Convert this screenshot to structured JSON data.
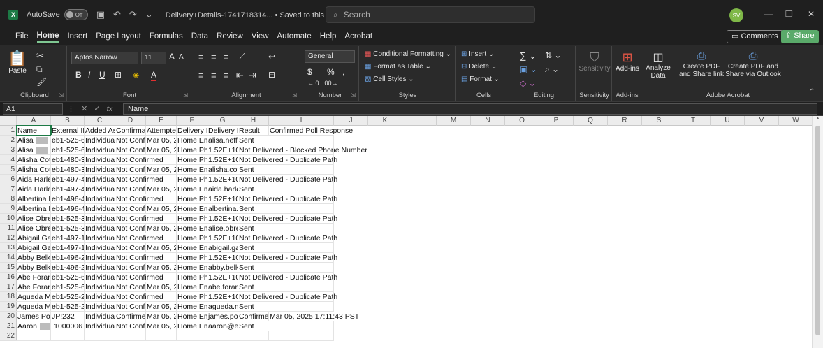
{
  "titlebar": {
    "app_logo": "X",
    "autosave_label": "AutoSave",
    "autosave_state": "Off",
    "doc_title": "Delivery+Details-1741718314... • Saved to this PC ∨",
    "search_placeholder": "Search",
    "user_initials": "SV"
  },
  "menu": {
    "tabs": [
      "File",
      "Home",
      "Insert",
      "Page Layout",
      "Formulas",
      "Data",
      "Review",
      "View",
      "Automate",
      "Help",
      "Acrobat"
    ],
    "active": "Home",
    "comments": "Comments",
    "share": "Share"
  },
  "ribbon": {
    "clipboard": {
      "paste": "Paste",
      "label": "Clipboard"
    },
    "font": {
      "name": "Aptos Narrow",
      "size": "11",
      "label": "Font"
    },
    "alignment": {
      "label": "Alignment"
    },
    "number": {
      "format": "General",
      "label": "Number"
    },
    "styles": {
      "conditional": "Conditional Formatting",
      "table": "Format as Table",
      "cell": "Cell Styles",
      "label": "Styles"
    },
    "cells": {
      "insert": "Insert",
      "delete": "Delete",
      "format": "Format",
      "label": "Cells"
    },
    "editing": {
      "label": "Editing"
    },
    "sensitivity": {
      "btn": "Sensitivity",
      "label": "Sensitivity"
    },
    "addins": {
      "btn": "Add-ins",
      "label": "Add-ins"
    },
    "analyze": {
      "btn1": "Analyze",
      "btn2": "Data"
    },
    "acrobat": {
      "pdf1a": "Create PDF",
      "pdf1b": "and Share link",
      "pdf2a": "Create PDF and",
      "pdf2b": "Share via Outlook",
      "label": "Adobe Acrobat"
    }
  },
  "formula_bar": {
    "cell_ref": "A1",
    "value": "Name"
  },
  "columns": [
    "A",
    "B",
    "C",
    "D",
    "E",
    "F",
    "G",
    "H",
    "I",
    "J",
    "K",
    "L",
    "M",
    "N",
    "O",
    "P",
    "Q",
    "R",
    "S",
    "T",
    "U",
    "V",
    "W"
  ],
  "row_numbers": [
    "1",
    "2",
    "3",
    "4",
    "5",
    "6",
    "7",
    "8",
    "9",
    "10",
    "11",
    "12",
    "13",
    "14",
    "15",
    "16",
    "17",
    "18",
    "19",
    "20",
    "21",
    "22"
  ],
  "rows": [
    [
      "Name",
      "External ID",
      "Added As",
      "Confirmati",
      "Attempted",
      "Delivery Pa",
      "Delivery Pa",
      "Result",
      "Confirmed Poll Response"
    ],
    [
      "Alisa",
      "eb1-525-6",
      "Individual",
      "Not Confirı",
      "Mar 05, 20",
      "Home Ema",
      "alisa.neff@",
      "Sent",
      ""
    ],
    [
      "Alisa",
      "eb1-525-6",
      "Individual",
      "Not Confirı",
      "Mar 05, 20",
      "Home Pho",
      "1.52E+10",
      "Not Delivered - Blocked Phone Number",
      ""
    ],
    [
      "Alisha Cott",
      "eb1-480-3",
      "Individual",
      "Not Confirmed",
      "",
      "Home Pho",
      "1.52E+10",
      "Not Delivered - Duplicate Path",
      ""
    ],
    [
      "Alisha Cott",
      "eb1-480-3",
      "Individual",
      "Not Confirı",
      "Mar 05, 20",
      "Home Ema",
      "alisha.cott",
      "Sent",
      ""
    ],
    [
      "Aida Harle",
      "eb1-497-4",
      "Individual",
      "Not Confirmed",
      "",
      "Home Pho",
      "1.52E+10",
      "Not Delivered - Duplicate Path",
      ""
    ],
    [
      "Aida Harle",
      "eb1-497-4",
      "Individual",
      "Not Confirı",
      "Mar 05, 20",
      "Home Ema",
      "aida.harley",
      "Sent",
      ""
    ],
    [
      "Albertina N",
      "eb1-496-4",
      "Individual",
      "Not Confirmed",
      "",
      "Home Pho",
      "1.52E+10",
      "Not Delivered - Duplicate Path",
      ""
    ],
    [
      "Albertina N",
      "eb1-496-4",
      "Individual",
      "Not Confirı",
      "Mar 05, 20",
      "Home Ema",
      "albertina.n",
      "Sent",
      ""
    ],
    [
      "Alise Obre",
      "eb1-525-3",
      "Individual",
      "Not Confirmed",
      "",
      "Home Pho",
      "1.52E+10",
      "Not Delivered - Duplicate Path",
      ""
    ],
    [
      "Alise Obre",
      "eb1-525-3",
      "Individual",
      "Not Confirı",
      "Mar 05, 20",
      "Home Ema",
      "alise.obre",
      "Sent",
      ""
    ],
    [
      "Abigail Gar",
      "eb1-497-1",
      "Individual",
      "Not Confirmed",
      "",
      "Home Pho",
      "1.52E+10",
      "Not Delivered - Duplicate Path",
      ""
    ],
    [
      "Abigail Gar",
      "eb1-497-1",
      "Individual",
      "Not Confirı",
      "Mar 05, 20",
      "Home Ema",
      "abigail.gar",
      "Sent",
      ""
    ],
    [
      "Abby Belk",
      "eb1-496-2",
      "Individual",
      "Not Confirmed",
      "",
      "Home Pho",
      "1.52E+10",
      "Not Delivered - Duplicate Path",
      ""
    ],
    [
      "Abby Belk",
      "eb1-496-2",
      "Individual",
      "Not Confirı",
      "Mar 05, 20",
      "Home Ema",
      "abby.belk@",
      "Sent",
      ""
    ],
    [
      "Abe Foran",
      "eb1-525-6",
      "Individual",
      "Not Confirmed",
      "",
      "Home Pho",
      "1.52E+10",
      "Not Delivered - Duplicate Path",
      ""
    ],
    [
      "Abe Foran",
      "eb1-525-6",
      "Individual",
      "Not Confirı",
      "Mar 05, 20",
      "Home Ema",
      "abe.foran@",
      "Sent",
      ""
    ],
    [
      "Agueda Mc",
      "eb1-525-2",
      "Individual",
      "Not Confirmed",
      "",
      "Home Pho",
      "1.52E+10",
      "Not Delivered - Duplicate Path",
      ""
    ],
    [
      "Agueda Mc",
      "eb1-525-2",
      "Individual",
      "Not Confirı",
      "Mar 05, 20",
      "Home Ema",
      "agueda.mc",
      "Sent",
      ""
    ],
    [
      "James Pod",
      "JP!232",
      "Individual",
      "Confirmed",
      "Mar 05, 20",
      "Home Ema",
      "james.pod",
      "Confirmed",
      "Mar 05, 2025 17:11:43 PST"
    ],
    [
      "Aaron",
      "1000006",
      "Individual",
      "Not Confirı",
      "Mar 05, 20",
      "Home Ema",
      "aaron@exa",
      "Sent",
      ""
    ],
    [
      "",
      "",
      "",
      "",
      "",
      "",
      "",
      "",
      ""
    ]
  ]
}
